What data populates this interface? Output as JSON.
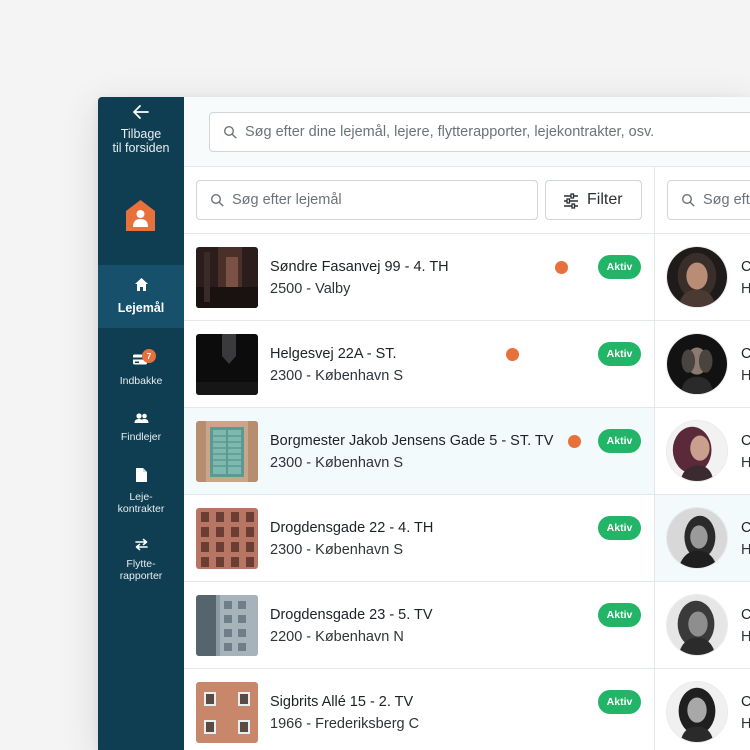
{
  "sidebar": {
    "back_label_line1": "Tilbage",
    "back_label_line2": "til forsiden",
    "items": [
      {
        "label": "Lejemål",
        "icon": "home-icon",
        "active": true
      },
      {
        "label": "Indbakke",
        "icon": "inbox-icon",
        "badge": "7"
      },
      {
        "label": "Findlejer",
        "icon": "users-icon"
      },
      {
        "label_line1": "Leje-",
        "label_line2": "kontrakter",
        "icon": "document-icon"
      },
      {
        "label_line1": "Flytte-",
        "label_line2": "rapporter",
        "icon": "swap-icon"
      }
    ]
  },
  "global_search": {
    "placeholder": "Søg efter dine lejemål, lejere, flytterapporter, lejekontrakter, osv."
  },
  "list_search": {
    "placeholder": "Søg efter lejemål"
  },
  "filter": {
    "label": "Filter"
  },
  "right_search": {
    "placeholder": "Søg efte"
  },
  "rentals": [
    {
      "address": "Søndre Fasanvej 99 - 4. TH",
      "city": "2500 - Valby",
      "status": "Aktiv",
      "notification": true
    },
    {
      "address": "Helgesvej 22A - ST.",
      "city": "2300 - København S",
      "status": "Aktiv",
      "notification": true
    },
    {
      "address": "Borgmester Jakob Jensens Gade 5 - ST. TV",
      "city": "2300 - København S",
      "status": "Aktiv",
      "notification": true
    },
    {
      "address": "Drogdensgade 22 - 4. TH",
      "city": "2300 - København S",
      "status": "Aktiv",
      "notification": false
    },
    {
      "address": "Drogdensgade 23 - 5. TV",
      "city": "2200 - København N",
      "status": "Aktiv",
      "notification": false
    },
    {
      "address": "Sigbrits Allé 15 - 2. TV",
      "city": "1966 - Frederiksberg C",
      "status": "Aktiv",
      "notification": false
    }
  ],
  "tenants": [
    {
      "initial": "C",
      "sub": "H"
    },
    {
      "initial": "C",
      "sub": "H"
    },
    {
      "initial": "C",
      "sub": "H"
    },
    {
      "initial": "C",
      "sub": "H"
    },
    {
      "initial": "C",
      "sub": "H"
    },
    {
      "initial": "C",
      "sub": "H"
    }
  ],
  "colors": {
    "sidebar": "#0f3e52",
    "sidebar_active": "#17506a",
    "accent_orange": "#e8703a",
    "status_green": "#22b467"
  }
}
